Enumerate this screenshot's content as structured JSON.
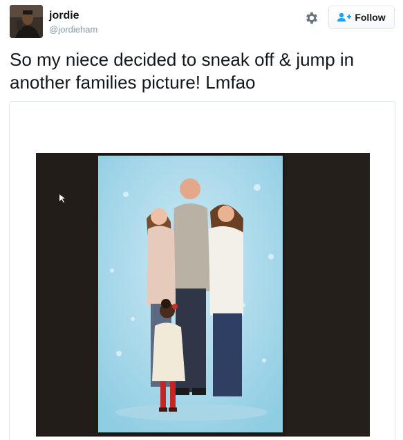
{
  "user": {
    "display_name": "jordie",
    "handle": "@jordieham"
  },
  "actions": {
    "follow_label": "Follow",
    "settings_icon": "gear-icon",
    "follow_icon": "add-user-icon"
  },
  "tweet": {
    "text": "So my niece decided to sneak off & jump in another families picture! Lmfao"
  },
  "colors": {
    "text": "#14171a",
    "muted": "#8899a6",
    "twitter_blue": "#1da1f2",
    "border": "#e1e8ed"
  }
}
